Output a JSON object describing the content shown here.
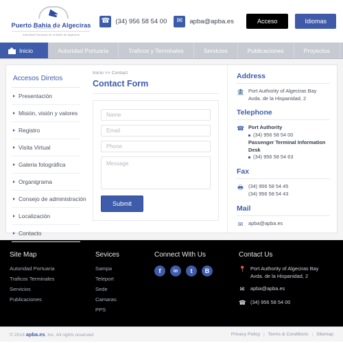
{
  "header": {
    "logo": {
      "name": "Puerto Bahia de Algeciras",
      "subtitle": "Autoridad Portuaria de la Bahia de Algeciras"
    },
    "phone_icon": "phone-icon",
    "phone": "(34) 956 58 54 00",
    "mail_icon": "mail-icon",
    "email": "apba@apba.es",
    "acceso_label": "Acceso",
    "idiomas_label": "Idiomas",
    "acceso_color": "#000000",
    "idiomas_color": "#4059a8"
  },
  "nav": {
    "items": [
      {
        "label": "Inicio",
        "active": true,
        "icon": "bank-icon"
      },
      {
        "label": "Autoridad Portuaria",
        "active": false
      },
      {
        "label": "Traficos y Terminales",
        "active": false
      },
      {
        "label": "Servicios",
        "active": false
      },
      {
        "label": "Publicaciones",
        "active": false
      },
      {
        "label": "Proyectos",
        "active": false
      }
    ],
    "active_color": "#3f5cab",
    "bar_color": "#c8cad2"
  },
  "sidebar": {
    "title": "Accesos Diretos",
    "items": [
      {
        "label": "Presentación"
      },
      {
        "label": "Misión, visión y valores"
      },
      {
        "label": "Registro"
      },
      {
        "label": "Visita Virtual"
      },
      {
        "label": "Galeria fotográfica"
      },
      {
        "label": "Organigrama"
      },
      {
        "label": "Consejo de administración"
      },
      {
        "label": "Localización"
      },
      {
        "label": "Contacto"
      }
    ]
  },
  "main": {
    "breadcrumb": "Inicio >> Contact",
    "title": "Contact Form",
    "form": {
      "name_placeholder": "Name",
      "name_value": "",
      "email_placeholder": "Email",
      "email_value": "",
      "phone_placeholder": "Phone",
      "phone_value": "",
      "message_placeholder": "Message",
      "message_value": "",
      "submit_label": "Submit"
    }
  },
  "contact_panel": {
    "address": {
      "title": "Address",
      "icon": "bank-icon",
      "line1": "Port Authority of Algeciras Bay",
      "line2": "Avda. de la Hispanidad, 2"
    },
    "telephone": {
      "title": "Telephone",
      "icon": "phone-icon",
      "entries": [
        {
          "label": "Port Authority",
          "number": "(34) 956 58 54 00"
        },
        {
          "label": "Passenger Terminal Information Desk",
          "number": "(34) 956 58 54 63"
        }
      ]
    },
    "fax": {
      "title": "Fax",
      "icon": "fax-icon",
      "numbers": [
        "(34) 956 58 54 45",
        "(34) 956 58 54 43"
      ]
    },
    "mail": {
      "title": "Mail",
      "icon": "mail-icon",
      "address": "apba@apba.es"
    }
  },
  "footer": {
    "sitemap": {
      "title": "Site Map",
      "links": [
        "Autoridad Portuaria",
        "Traficos Terminales",
        "Servicios",
        "Publicaciones"
      ]
    },
    "services": {
      "title": "Sevices",
      "links": [
        "Sampa",
        "Teleport",
        "Sede",
        "Camaras",
        "PPS"
      ]
    },
    "connect": {
      "title": "Connect With Us",
      "socials": [
        {
          "name": "facebook-icon",
          "glyph": "f"
        },
        {
          "name": "linkedin-icon",
          "glyph": "in"
        },
        {
          "name": "twitter-icon",
          "glyph": "t"
        },
        {
          "name": "blogger-icon",
          "glyph": "B"
        }
      ],
      "color": "#3f5cab"
    },
    "contact": {
      "title": "Contact Us",
      "address_icon": "location-pin-icon",
      "address_line1": "Port Authority of Algeciras Bay",
      "address_line2": "Avda. de la Hispanidad, 2",
      "mail_icon": "mail-icon",
      "email": "apba@apba.es",
      "phone_icon": "phone-icon",
      "phone": "(34) 956 58 54 00"
    }
  },
  "bottombar": {
    "copyright_pre": "© 2014 ",
    "brand": "apba.es",
    "copyright_post": ", Inc. All rights reserved",
    "links": [
      "Privacy Policy",
      "Terms & Conditions",
      "Sitemap"
    ]
  }
}
